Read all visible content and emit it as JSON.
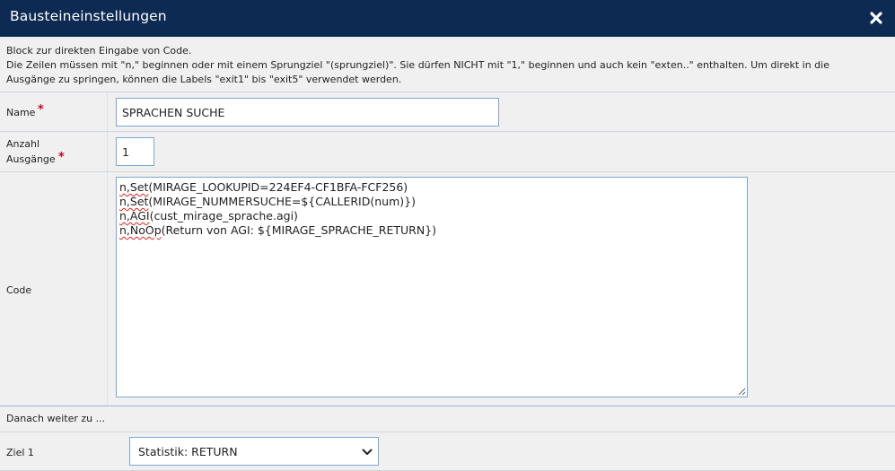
{
  "dialog": {
    "title": "Bausteineinstellungen",
    "close_icon": "close-icon"
  },
  "description": {
    "line1": "Block zur direkten Eingabe von Code.",
    "line2": "Die Zeilen müssen mit \"n,\" beginnen oder mit einem Sprungziel \"(sprungziel)\". Sie dürfen NICHT mit \"1,\" beginnen und auch kein \"exten..\" enthalten. Um direkt in die",
    "line3": "Ausgänge zu springen, können die Labels \"exit1\" bis \"exit5\" verwendet werden."
  },
  "form": {
    "name_label": "Name",
    "name_value": "SPRACHEN SUCHE",
    "exits_label_line1": "Anzahl",
    "exits_label_line2": "Ausgänge",
    "exits_value": "1",
    "required_marker": "*",
    "code_label": "Code",
    "code_lines": [
      {
        "pre": "n,Set",
        "rest": "(MIRAGE_LOOKUPID=224EF4-CF1BFA-FCF256)"
      },
      {
        "pre": "n,Set",
        "rest": "(MIRAGE_NUMMERSUCHE=${CALLERID(num)})"
      },
      {
        "pre": "n,AGI",
        "rest": "(cust_mirage_sprache.agi)"
      },
      {
        "pre": "n,NoOp",
        "rest": "(Return von AGI: ${MIRAGE_SPRACHE_RETURN})"
      }
    ],
    "then_label": "Danach weiter zu ...",
    "target_label": "Ziel 1",
    "target_value": "Statistik: RETURN"
  },
  "colors": {
    "titlebar": "#0c2a52",
    "required": "#d0021b",
    "input_border": "#7ba7d1"
  }
}
